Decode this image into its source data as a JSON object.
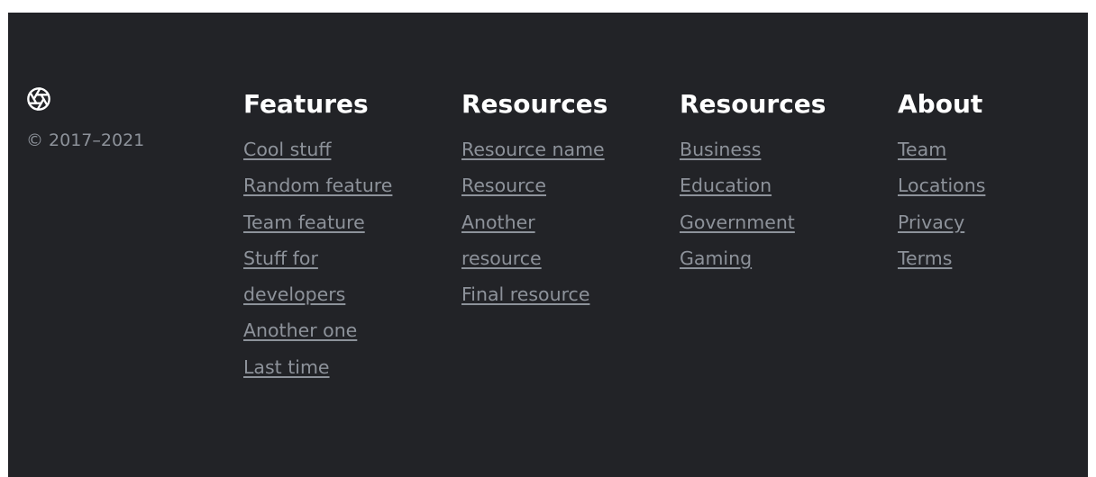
{
  "footer": {
    "logo_icon": "aperture-icon",
    "copyright": "© 2017–2021",
    "columns": [
      {
        "title": "Features",
        "links": [
          "Cool stuff",
          "Random feature",
          "Team feature",
          "Stuff for developers",
          "Another one",
          "Last time"
        ]
      },
      {
        "title": "Resources",
        "links": [
          "Resource name",
          "Resource",
          "Another resource",
          "Final resource"
        ]
      },
      {
        "title": "Resources",
        "links": [
          "Business",
          "Education",
          "Government",
          "Gaming"
        ]
      },
      {
        "title": "About",
        "links": [
          "Team",
          "Locations",
          "Privacy",
          "Terms"
        ]
      }
    ],
    "colors": {
      "background": "#222327",
      "heading": "#ffffff",
      "muted": "#8d929a"
    }
  }
}
